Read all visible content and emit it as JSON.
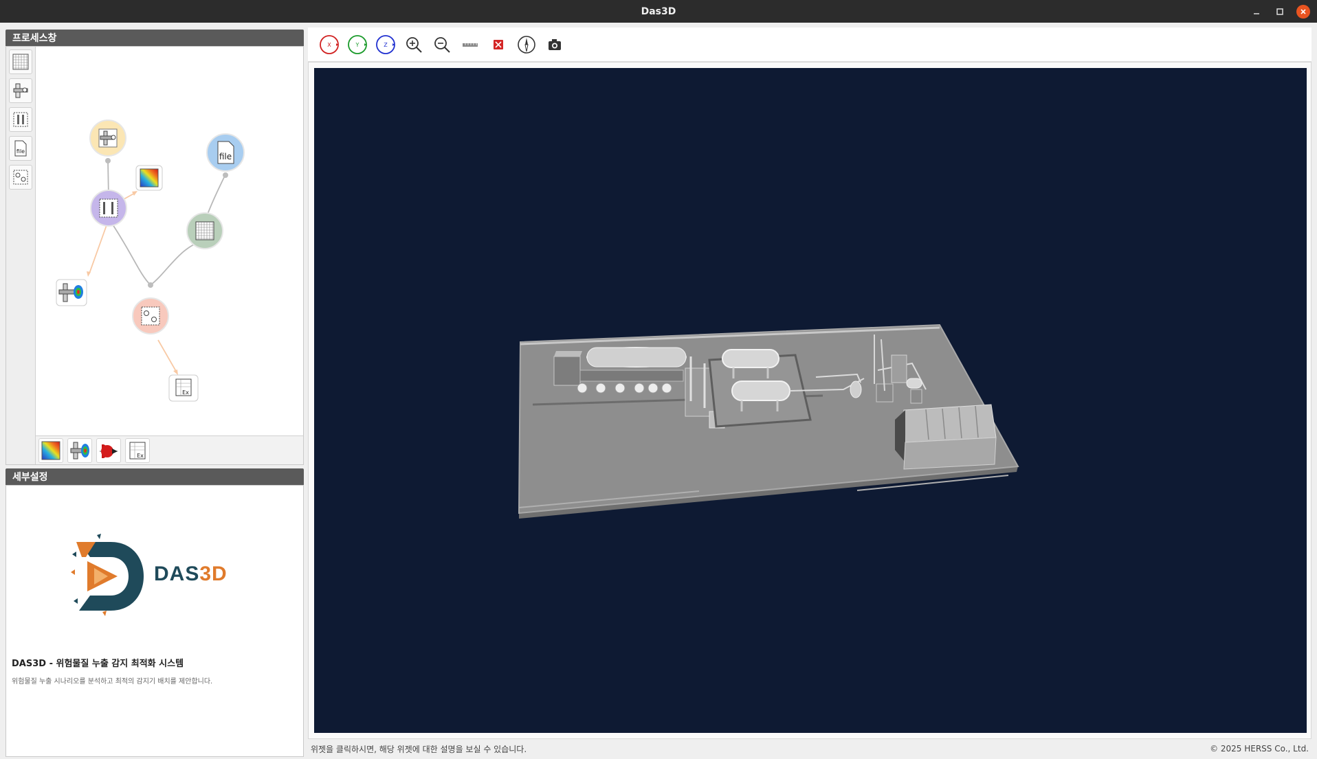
{
  "window": {
    "title": "Das3D"
  },
  "process_panel": {
    "header": "프로세스창",
    "tools": [
      "grid-tool",
      "pipe-tool",
      "frame-tool",
      "file-tool",
      "layout-tool"
    ],
    "palette": [
      "heatmap",
      "pipe-spectrum",
      "droplet",
      "excel"
    ],
    "nodes": {
      "file_label": "file",
      "excel_label": "Ex"
    }
  },
  "detail_panel": {
    "header": "세부설정",
    "logo": {
      "text_das": "DAS",
      "text_3d": "3D"
    },
    "title": "DAS3D - 위험물질 누출 감지 최적화 시스템",
    "description": "위험물질 누출 시나리오를 분석하고 최적의 감지기 배치를 제안합니다."
  },
  "toolbar": {
    "buttons": [
      {
        "name": "x-axis-button",
        "label": "X",
        "color": "#d02020"
      },
      {
        "name": "y-axis-button",
        "label": "Y",
        "color": "#1a9a2a"
      },
      {
        "name": "z-axis-button",
        "label": "Z",
        "color": "#2030d0"
      },
      {
        "name": "zoom-in-button"
      },
      {
        "name": "zoom-out-button"
      },
      {
        "name": "ruler-button"
      },
      {
        "name": "clear-button"
      },
      {
        "name": "compass-button"
      },
      {
        "name": "camera-button"
      }
    ]
  },
  "status": {
    "hint": "위젯을 클릭하시면, 해당 위젯에 대한 설명을 보실 수 있습니다.",
    "copyright": "© 2025 HERSS Co., Ltd."
  },
  "colors": {
    "viewport_bg": "#0e1a33",
    "node_yellow": "#fbe6b4",
    "node_blue": "#a8cdf0",
    "node_purple": "#c5b6ea",
    "node_green": "#b9cfba",
    "node_pink": "#f8c9bd"
  }
}
